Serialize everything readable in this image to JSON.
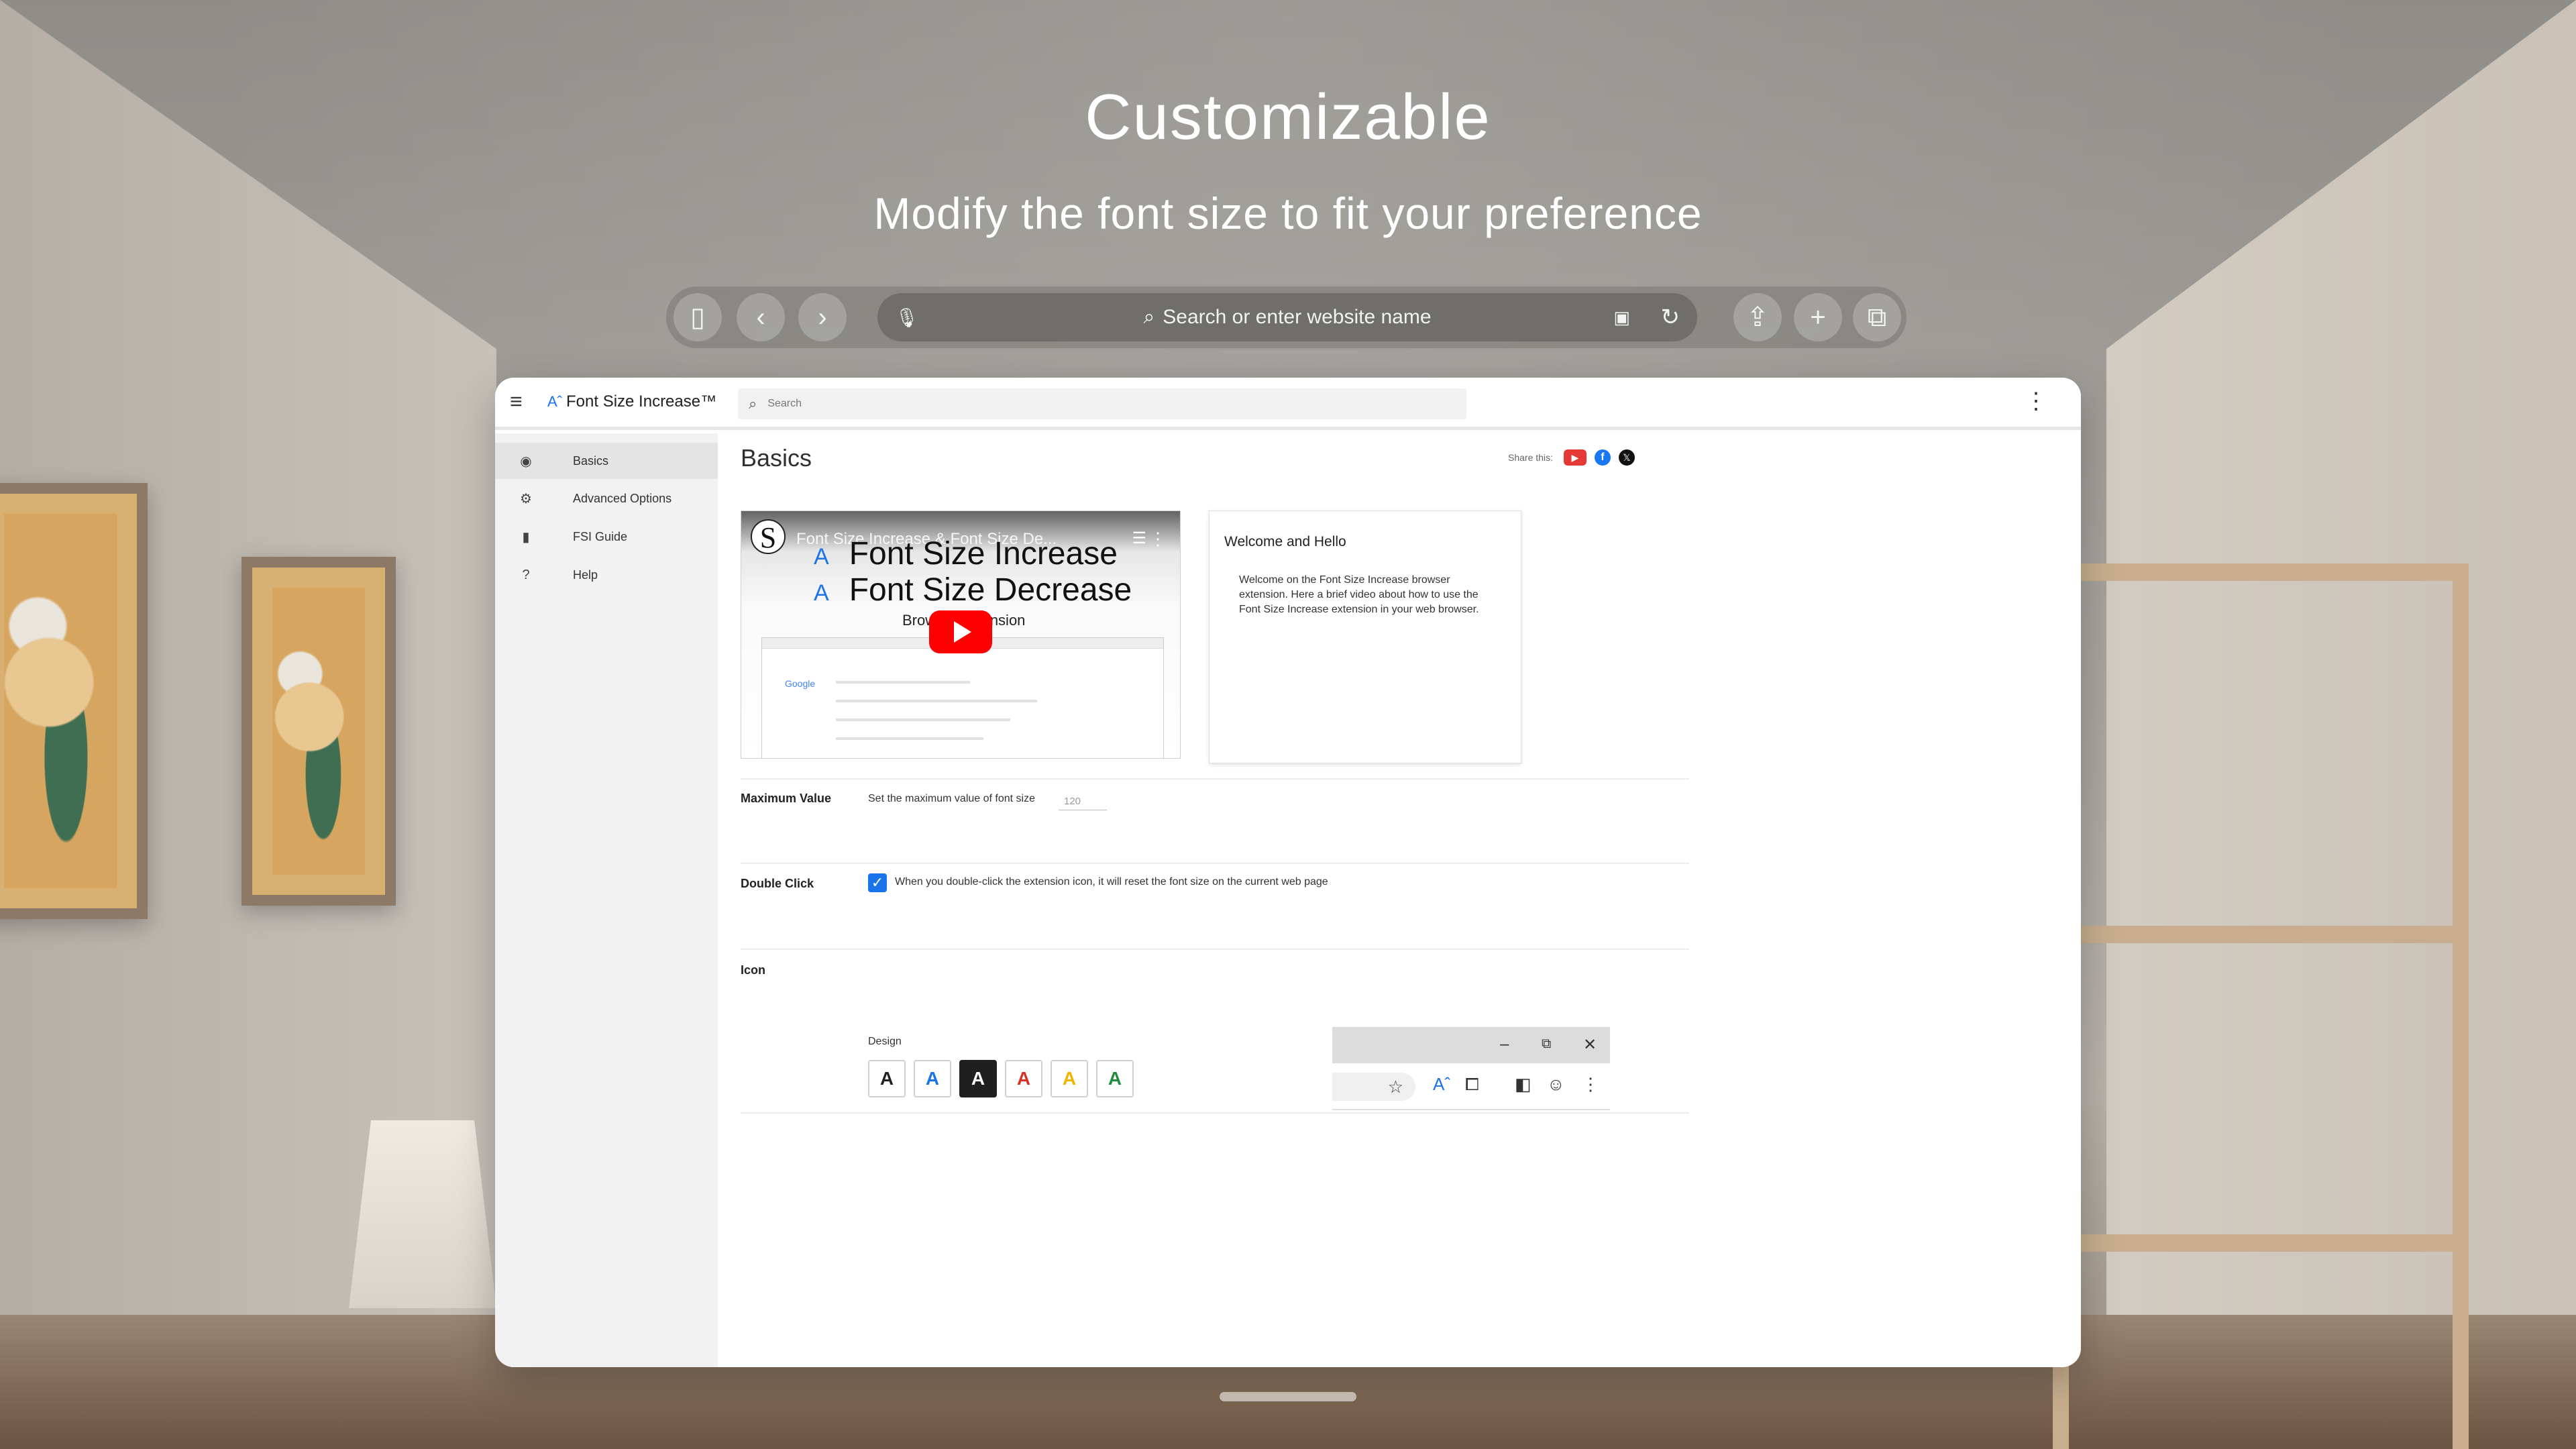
{
  "hero": {
    "title": "Customizable",
    "subtitle": "Modify the font size to fit your preference"
  },
  "browser": {
    "search_placeholder": "Search or enter website name",
    "icons": [
      "sidebar-icon",
      "back-icon",
      "forward-icon",
      "microphone-icon",
      "reader-icon",
      "reload-icon",
      "share-icon",
      "plus-icon",
      "tabs-icon"
    ]
  },
  "app": {
    "name": "Font Size Increase™",
    "search_placeholder": "Search",
    "page_title": "Basics",
    "share_label": "Share this:",
    "sidebar": [
      {
        "label": "Basics",
        "icon": "palette-icon"
      },
      {
        "label": "Advanced Options",
        "icon": "settings-icon"
      },
      {
        "label": "FSI Guide",
        "icon": "bookmark-icon"
      },
      {
        "label": "Help",
        "icon": "help-icon"
      }
    ],
    "video": {
      "title": "Font Size Increase & Font Size De...",
      "line1": "Font Size Increase",
      "line2": "Font Size Decrease",
      "line3": "Browser Extension"
    },
    "welcome": {
      "title": "Welcome and Hello",
      "body": "Welcome on the Font Size Increase browser extension. Here a brief video about how to use the Font Size Increase extension in your web browser."
    },
    "maximum": {
      "label": "Maximum Value",
      "description": "Set the maximum value of font size",
      "value": "120"
    },
    "double_click": {
      "label": "Double Click",
      "description": "When you double-click the extension icon, it will reset the font size on the current web page",
      "checked": true
    },
    "icon_section": {
      "label": "Icon",
      "design_label": "Design",
      "options": [
        {
          "glyph": "A",
          "color": "#222222"
        },
        {
          "glyph": "A",
          "color": "#1a73e8"
        },
        {
          "glyph": "A",
          "color": "#ffffff"
        },
        {
          "glyph": "A",
          "color": "#d93025"
        },
        {
          "glyph": "A",
          "color": "#f2b400"
        },
        {
          "glyph": "A",
          "color": "#1e8e3e"
        }
      ],
      "selected_index": 2
    },
    "preview": {
      "window_controls": [
        "–",
        "⧉",
        "✕"
      ]
    }
  },
  "colors": {
    "accent": "#1a73e8",
    "youtube": "#ff0000"
  }
}
